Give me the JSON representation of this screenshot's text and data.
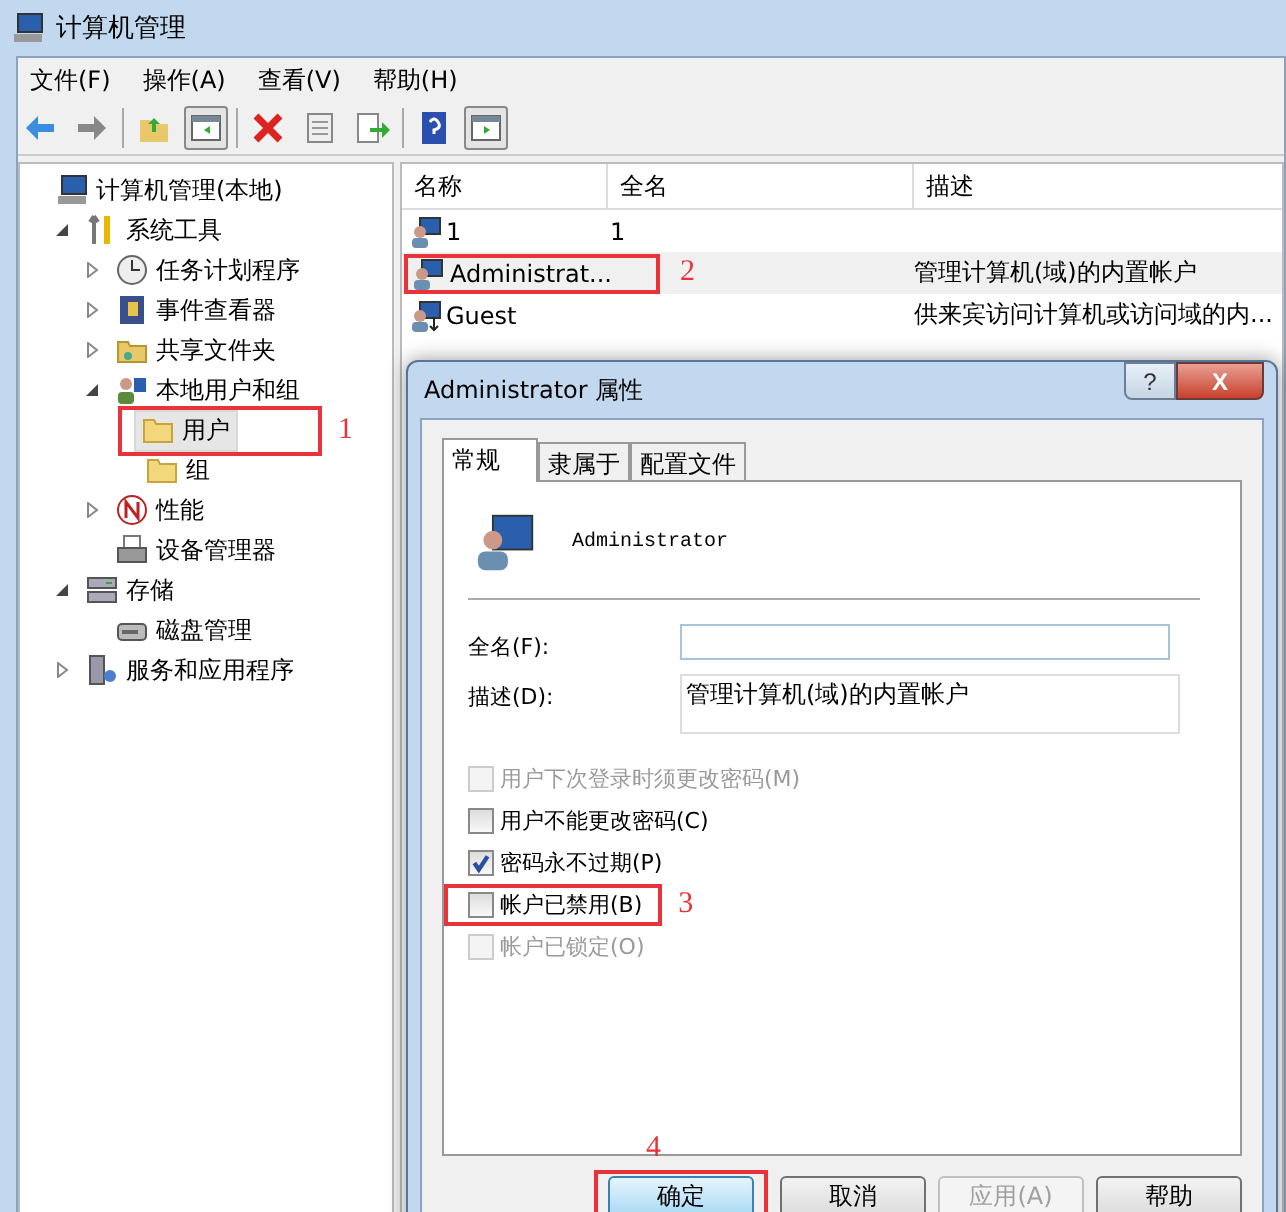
{
  "window": {
    "title": "计算机管理"
  },
  "menu": [
    "文件(F)",
    "操作(A)",
    "查看(V)",
    "帮助(H)"
  ],
  "toolbar": [
    [
      {
        "kind": "back",
        "pressed": false
      },
      {
        "kind": "forward",
        "pressed": false
      }
    ],
    [
      {
        "kind": "up",
        "pressed": false
      },
      {
        "kind": "tree-toggle",
        "pressed": true
      }
    ],
    [
      {
        "kind": "delete",
        "pressed": false
      },
      {
        "kind": "properties",
        "pressed": false
      },
      {
        "kind": "export",
        "pressed": false
      }
    ],
    [
      {
        "kind": "help",
        "pressed": false
      },
      {
        "kind": "action-pane",
        "pressed": true
      }
    ]
  ],
  "tree": [
    {
      "label": "计算机管理(本地)",
      "kind": "computer",
      "selected": false,
      "children": [
        {
          "label": "系统工具",
          "kind": "tools",
          "expanded": true,
          "selected": false,
          "children": [
            {
              "label": "任务计划程序",
              "kind": "clock",
              "expanded": false,
              "selected": false
            },
            {
              "label": "事件查看器",
              "kind": "log",
              "expanded": false,
              "selected": false
            },
            {
              "label": "共享文件夹",
              "kind": "share",
              "expanded": false,
              "selected": false
            },
            {
              "label": "本地用户和组",
              "kind": "users",
              "expanded": true,
              "selected": false,
              "children": [
                {
                  "label": "用户",
                  "kind": "folder",
                  "selected": true,
                  "annotation": "1"
                },
                {
                  "label": "组",
                  "kind": "folder",
                  "selected": false
                }
              ]
            },
            {
              "label": "性能",
              "kind": "perf",
              "expanded": false,
              "selected": false
            },
            {
              "label": "设备管理器",
              "kind": "device",
              "selected": false
            }
          ]
        },
        {
          "label": "存储",
          "kind": "storage",
          "expanded": true,
          "selected": false,
          "children": [
            {
              "label": "磁盘管理",
              "kind": "disk",
              "selected": false
            }
          ]
        },
        {
          "label": "服务和应用程序",
          "kind": "services",
          "expanded": false,
          "selected": false
        }
      ]
    }
  ],
  "list": {
    "columns": [
      "名称",
      "全名",
      "描述"
    ],
    "rows": [
      {
        "name": "1",
        "full_name": "1",
        "kind": "user",
        "selected": false
      },
      {
        "name": "Administrat...",
        "description": "管理计算机(域)的内置帐户",
        "kind": "user",
        "selected": true,
        "annotation": "2"
      },
      {
        "name": "Guest",
        "description": "供来宾访问计算机或访问域的内...",
        "kind": "guest",
        "selected": false
      }
    ]
  },
  "dialog": {
    "title": "Administrator 属性",
    "help_button": "?",
    "close_button": "X",
    "tabs": [
      {
        "label": "常规",
        "selected": true
      },
      {
        "label": "隶属于",
        "selected": false
      },
      {
        "label": "配置文件",
        "selected": false
      }
    ],
    "user_name": "Administrator",
    "fields": [
      {
        "label": "全名(F):"
      },
      {
        "label": "描述(D):",
        "value": "管理计算机(域)的内置帐户"
      }
    ],
    "checkboxes": [
      {
        "label": "用户下次登录时须更改密码(M)",
        "checked": false,
        "disabled": true
      },
      {
        "label": "用户不能更改密码(C)",
        "checked": false,
        "disabled": false
      },
      {
        "label": "密码永不过期(P)",
        "checked": true,
        "disabled": false
      },
      {
        "label": "帐户已禁用(B)",
        "checked": false,
        "disabled": false,
        "annotation": "3"
      },
      {
        "label": "帐户已锁定(O)",
        "checked": false,
        "disabled": true
      }
    ],
    "buttons": [
      {
        "label": "确定",
        "disabled": false,
        "default": true,
        "annotation": "4"
      },
      {
        "label": "取消",
        "disabled": false,
        "default": false
      },
      {
        "label": "应用(A)",
        "disabled": true,
        "default": false
      },
      {
        "label": "帮助",
        "disabled": false,
        "default": false
      }
    ]
  }
}
